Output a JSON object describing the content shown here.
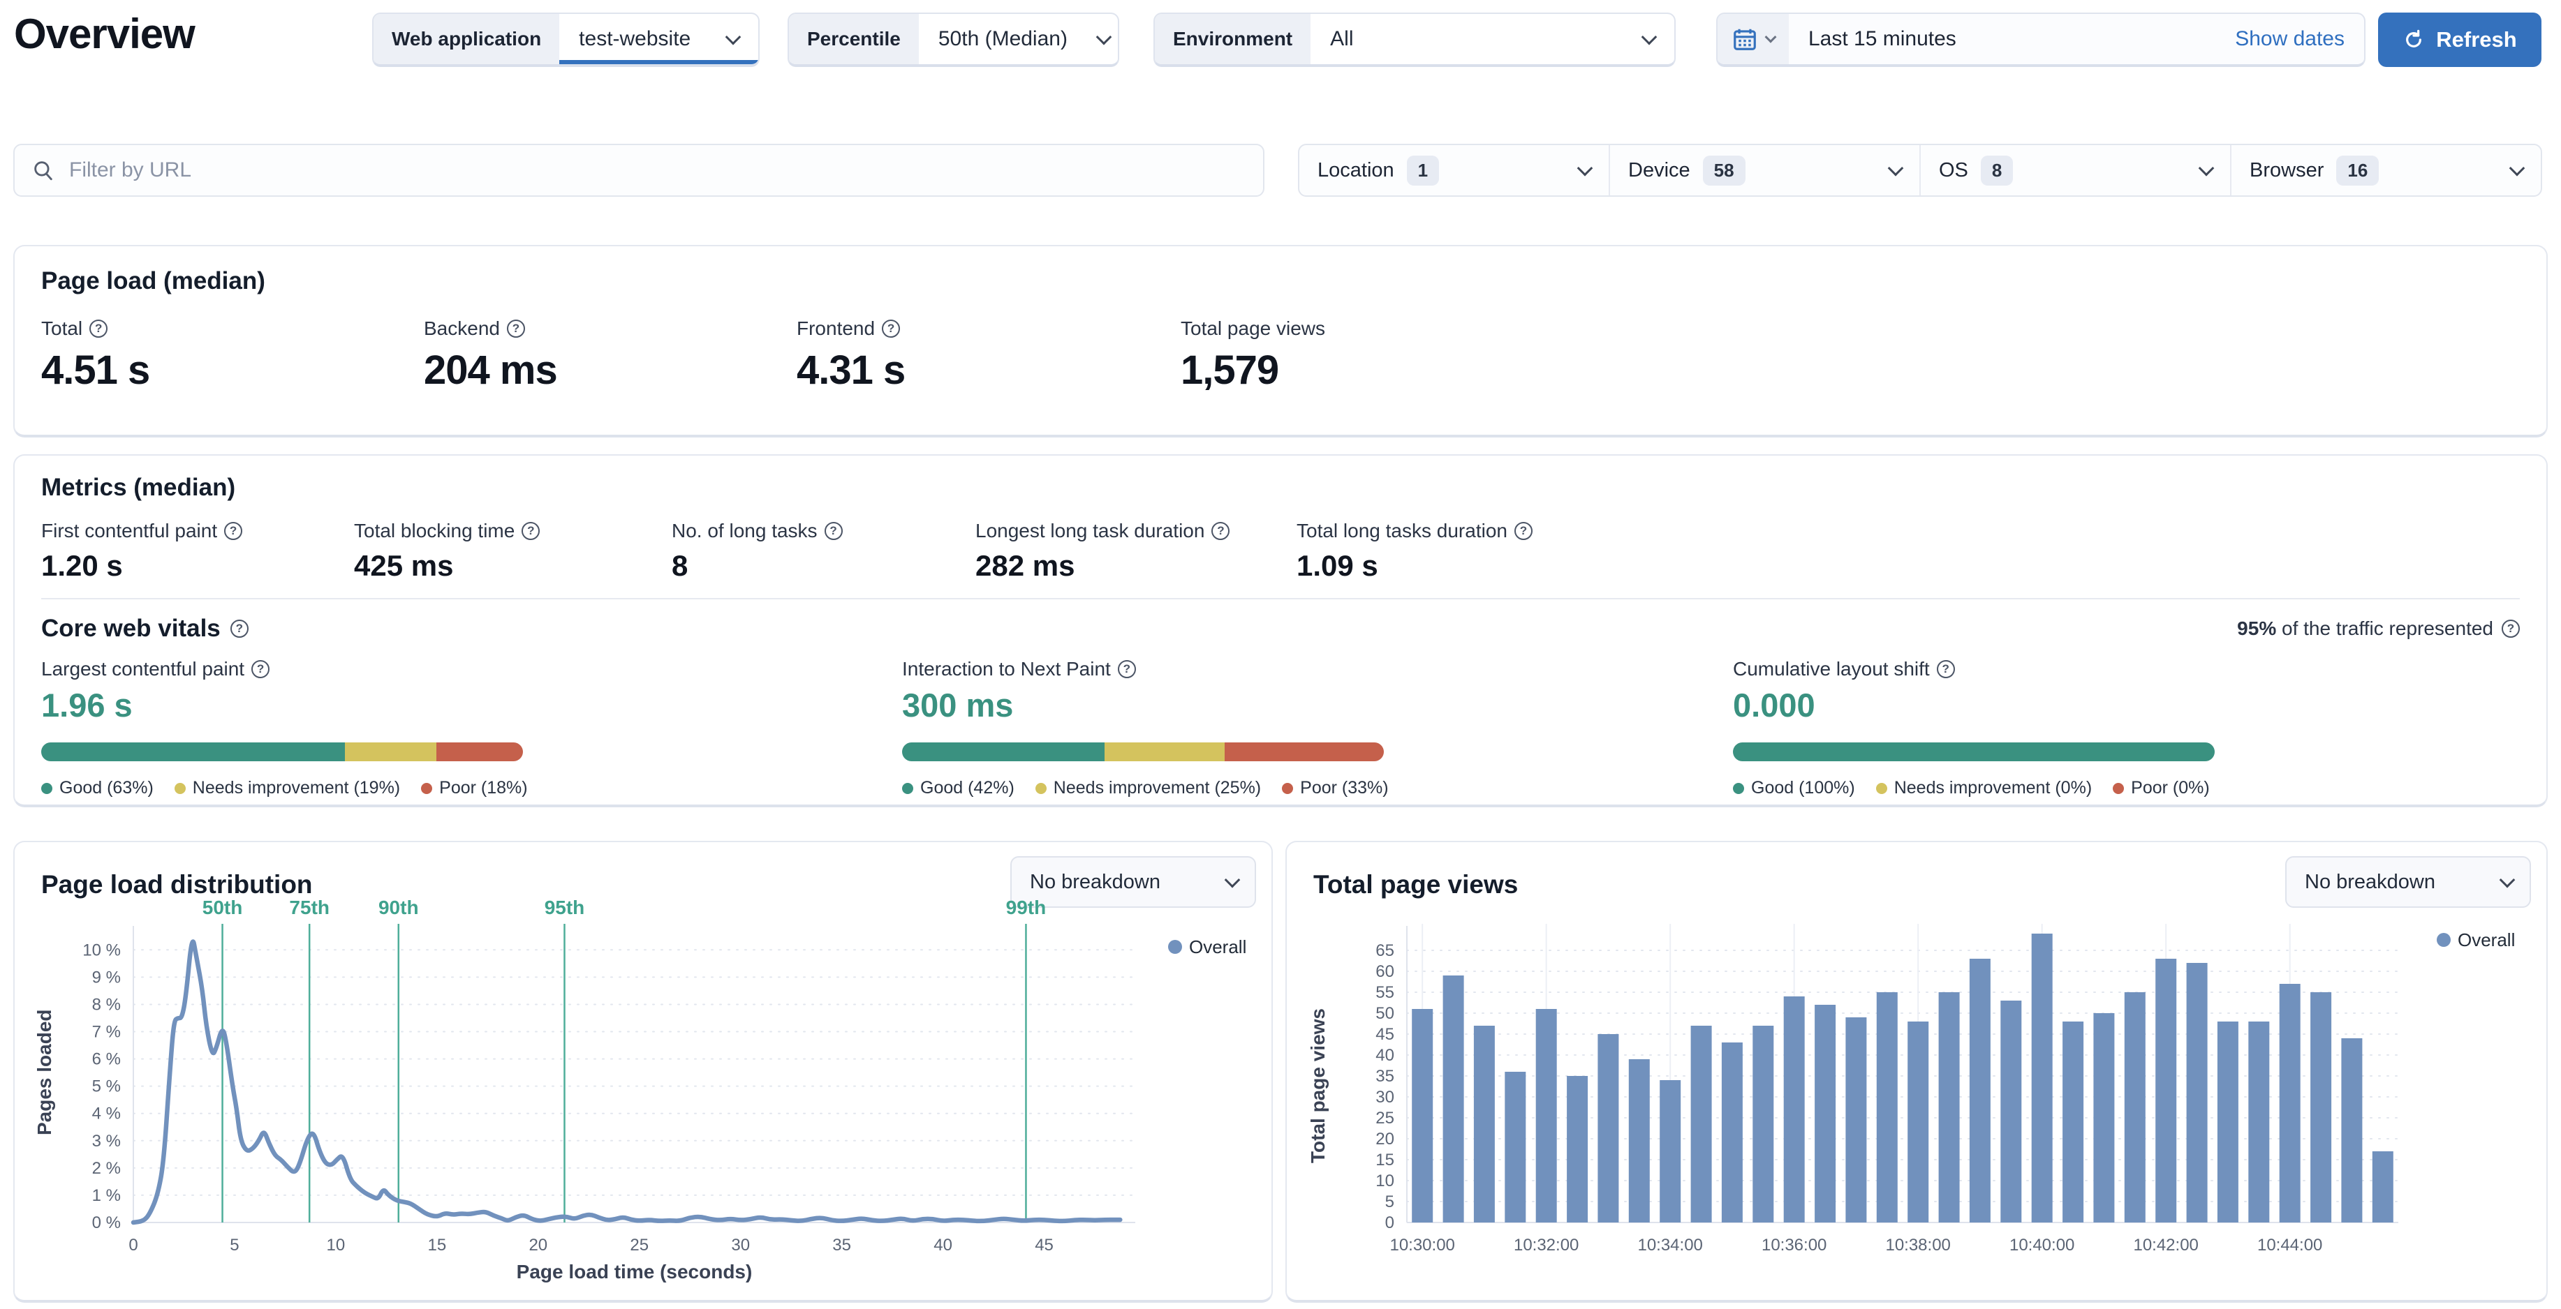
{
  "page": {
    "title": "Overview"
  },
  "toolbar": {
    "app_filter": {
      "label": "Web application",
      "value": "test-website"
    },
    "percentile_filter": {
      "label": "Percentile",
      "value": "50th (Median)"
    },
    "environment_filter": {
      "label": "Environment",
      "value": "All"
    },
    "time_range": {
      "value": "Last 15 minutes",
      "show_dates_label": "Show dates"
    },
    "refresh_label": "Refresh"
  },
  "filters": {
    "url_placeholder": "Filter by URL",
    "dropdowns": [
      {
        "label": "Location",
        "count": "1"
      },
      {
        "label": "Device",
        "count": "58"
      },
      {
        "label": "OS",
        "count": "8"
      },
      {
        "label": "Browser",
        "count": "16"
      }
    ]
  },
  "page_load_card": {
    "title": "Page load (median)",
    "stats": [
      {
        "label": "Total",
        "value": "4.51 s"
      },
      {
        "label": "Backend",
        "value": "204 ms"
      },
      {
        "label": "Frontend",
        "value": "4.31 s"
      },
      {
        "label": "Total page views",
        "value": "1,579"
      }
    ]
  },
  "metrics_card": {
    "title": "Metrics (median)",
    "stats": [
      {
        "label": "First contentful paint",
        "value": "1.20 s"
      },
      {
        "label": "Total blocking time",
        "value": "425 ms"
      },
      {
        "label": "No. of long tasks",
        "value": "8"
      },
      {
        "label": "Longest long task duration",
        "value": "282 ms"
      },
      {
        "label": "Total long tasks duration",
        "value": "1.09 s"
      }
    ]
  },
  "core_web_vitals": {
    "title": "Core web vitals",
    "traffic_note_strong": "95%",
    "traffic_note_rest": " of the traffic represented",
    "colors": {
      "good": "#3a9180",
      "needs_improvement": "#d4c35e",
      "poor": "#c5604b"
    },
    "vitals": [
      {
        "label": "Largest contentful paint",
        "value": "1.96 s",
        "good": 63,
        "needs_improvement": 19,
        "poor": 18,
        "legend": [
          "Good (63%)",
          "Needs improvement (19%)",
          "Poor (18%)"
        ]
      },
      {
        "label": "Interaction to Next Paint",
        "value": "300 ms",
        "good": 42,
        "needs_improvement": 25,
        "poor": 33,
        "legend": [
          "Good (42%)",
          "Needs improvement (25%)",
          "Poor (33%)"
        ]
      },
      {
        "label": "Cumulative layout shift",
        "value": "0.000",
        "good": 100,
        "needs_improvement": 0,
        "poor": 0,
        "legend": [
          "Good (100%)",
          "Needs improvement (0%)",
          "Poor (0%)"
        ]
      }
    ]
  },
  "distribution_card": {
    "title": "Page load distribution",
    "breakdown_value": "No breakdown"
  },
  "pageviews_card": {
    "title": "Total page views",
    "breakdown_value": "No breakdown"
  },
  "chart_data": [
    {
      "type": "line",
      "title": "Page load distribution",
      "xlabel": "Page load time (seconds)",
      "ylabel": "Pages loaded",
      "legend": "Overall",
      "legend_position": "top-right",
      "grid": true,
      "color": "#7191bd",
      "percentile_color": "#4fae9a",
      "xlim": [
        0,
        49.5
      ],
      "ylim": [
        0,
        10.75
      ],
      "xticks": [
        0,
        5,
        10,
        15,
        20,
        25,
        30,
        35,
        40,
        45
      ],
      "yticks": [
        0,
        1,
        2,
        3,
        4,
        5,
        6,
        7,
        8,
        9,
        10
      ],
      "ytick_suffix": " %",
      "percentiles": [
        {
          "label": "50th",
          "x": 4.4
        },
        {
          "label": "75th",
          "x": 8.7
        },
        {
          "label": "90th",
          "x": 13.1
        },
        {
          "label": "95th",
          "x": 21.3
        },
        {
          "label": "99th",
          "x": 44.1
        }
      ],
      "points": [
        [
          0,
          0
        ],
        [
          0.5,
          0.05
        ],
        [
          0.8,
          0.3
        ],
        [
          1.2,
          1.0
        ],
        [
          1.5,
          2.2
        ],
        [
          1.8,
          5.5
        ],
        [
          2.0,
          7.4
        ],
        [
          2.2,
          7.5
        ],
        [
          2.4,
          7.5
        ],
        [
          2.6,
          8.3
        ],
        [
          2.9,
          10.6
        ],
        [
          3.1,
          9.8
        ],
        [
          3.4,
          8.6
        ],
        [
          3.6,
          7.2
        ],
        [
          3.9,
          6.1
        ],
        [
          4.1,
          6.4
        ],
        [
          4.4,
          7.2
        ],
        [
          4.6,
          6.6
        ],
        [
          4.9,
          5.0
        ],
        [
          5.1,
          4.2
        ],
        [
          5.3,
          3.0
        ],
        [
          5.6,
          2.6
        ],
        [
          5.9,
          2.7
        ],
        [
          6.2,
          3.0
        ],
        [
          6.45,
          3.4
        ],
        [
          6.7,
          2.9
        ],
        [
          7.0,
          2.45
        ],
        [
          7.3,
          2.3
        ],
        [
          7.6,
          2.05
        ],
        [
          7.95,
          1.8
        ],
        [
          8.2,
          2.1
        ],
        [
          8.6,
          3.1
        ],
        [
          8.9,
          3.35
        ],
        [
          9.2,
          2.6
        ],
        [
          9.5,
          2.15
        ],
        [
          9.8,
          2.1
        ],
        [
          10.05,
          2.3
        ],
        [
          10.35,
          2.5
        ],
        [
          10.7,
          1.6
        ],
        [
          11.0,
          1.35
        ],
        [
          11.4,
          1.1
        ],
        [
          11.8,
          0.95
        ],
        [
          12.1,
          0.85
        ],
        [
          12.35,
          1.25
        ],
        [
          12.6,
          1.0
        ],
        [
          13.0,
          0.8
        ],
        [
          13.4,
          0.75
        ],
        [
          13.7,
          0.7
        ],
        [
          14.1,
          0.5
        ],
        [
          14.5,
          0.3
        ],
        [
          15.0,
          0.2
        ],
        [
          15.4,
          0.35
        ],
        [
          15.8,
          0.28
        ],
        [
          16.2,
          0.33
        ],
        [
          16.6,
          0.3
        ],
        [
          17.0,
          0.36
        ],
        [
          17.4,
          0.4
        ],
        [
          17.8,
          0.25
        ],
        [
          18.2,
          0.15
        ],
        [
          18.5,
          0.05
        ],
        [
          18.9,
          0.2
        ],
        [
          19.3,
          0.28
        ],
        [
          19.7,
          0.12
        ],
        [
          20.1,
          0.05
        ],
        [
          20.5,
          0.12
        ],
        [
          21.0,
          0.2
        ],
        [
          21.4,
          0.22
        ],
        [
          21.8,
          0.12
        ],
        [
          22.2,
          0.25
        ],
        [
          22.6,
          0.3
        ],
        [
          23.0,
          0.18
        ],
        [
          23.4,
          0.08
        ],
        [
          23.8,
          0.12
        ],
        [
          24.2,
          0.2
        ],
        [
          24.6,
          0.1
        ],
        [
          25.0,
          0.06
        ],
        [
          25.5,
          0.1
        ],
        [
          26.0,
          0.05
        ],
        [
          26.5,
          0.08
        ],
        [
          27.0,
          0.05
        ],
        [
          27.5,
          0.18
        ],
        [
          28.0,
          0.22
        ],
        [
          28.5,
          0.12
        ],
        [
          29.0,
          0.08
        ],
        [
          29.5,
          0.14
        ],
        [
          30.0,
          0.08
        ],
        [
          30.5,
          0.12
        ],
        [
          31.0,
          0.2
        ],
        [
          31.5,
          0.1
        ],
        [
          32.0,
          0.12
        ],
        [
          32.5,
          0.08
        ],
        [
          33.0,
          0.05
        ],
        [
          33.5,
          0.13
        ],
        [
          34.0,
          0.18
        ],
        [
          34.5,
          0.08
        ],
        [
          35.0,
          0.05
        ],
        [
          35.5,
          0.1
        ],
        [
          36.0,
          0.15
        ],
        [
          36.5,
          0.08
        ],
        [
          37.0,
          0.05
        ],
        [
          37.5,
          0.1
        ],
        [
          38.0,
          0.15
        ],
        [
          38.5,
          0.05
        ],
        [
          39.0,
          0.13
        ],
        [
          39.5,
          0.13
        ],
        [
          40.0,
          0.05
        ],
        [
          40.5,
          0.1
        ],
        [
          41.0,
          0.1
        ],
        [
          41.5,
          0.06
        ],
        [
          42.0,
          0.05
        ],
        [
          42.5,
          0.1
        ],
        [
          43.0,
          0.14
        ],
        [
          43.5,
          0.1
        ],
        [
          44.0,
          0.06
        ],
        [
          44.5,
          0.1
        ],
        [
          45.0,
          0.1
        ],
        [
          45.5,
          0.06
        ],
        [
          46.0,
          0.05
        ],
        [
          46.5,
          0.09
        ],
        [
          47.0,
          0.1
        ],
        [
          47.5,
          0.08
        ],
        [
          48.0,
          0.1
        ],
        [
          48.5,
          0.1
        ],
        [
          49.0,
          0.1
        ]
      ]
    },
    {
      "type": "bar",
      "title": "Total page views",
      "ylabel": "Total page views",
      "legend": "Overall",
      "legend_position": "top-right",
      "grid": true,
      "color": "#7191bd",
      "ylim": [
        0,
        70
      ],
      "ytick_step": 5,
      "ytick_max": 65,
      "values": [
        51,
        59,
        47,
        36,
        51,
        35,
        45,
        39,
        34,
        47,
        43,
        47,
        54,
        52,
        49,
        55,
        48,
        55,
        63,
        53,
        69,
        48,
        50,
        55,
        63,
        62,
        48,
        48,
        57,
        55,
        44,
        17
      ],
      "x_labels": [
        "10:30:00",
        "10:32:00",
        "10:34:00",
        "10:36:00",
        "10:38:00",
        "10:40:00",
        "10:42:00",
        "10:44:00"
      ],
      "label_every": 4
    }
  ]
}
